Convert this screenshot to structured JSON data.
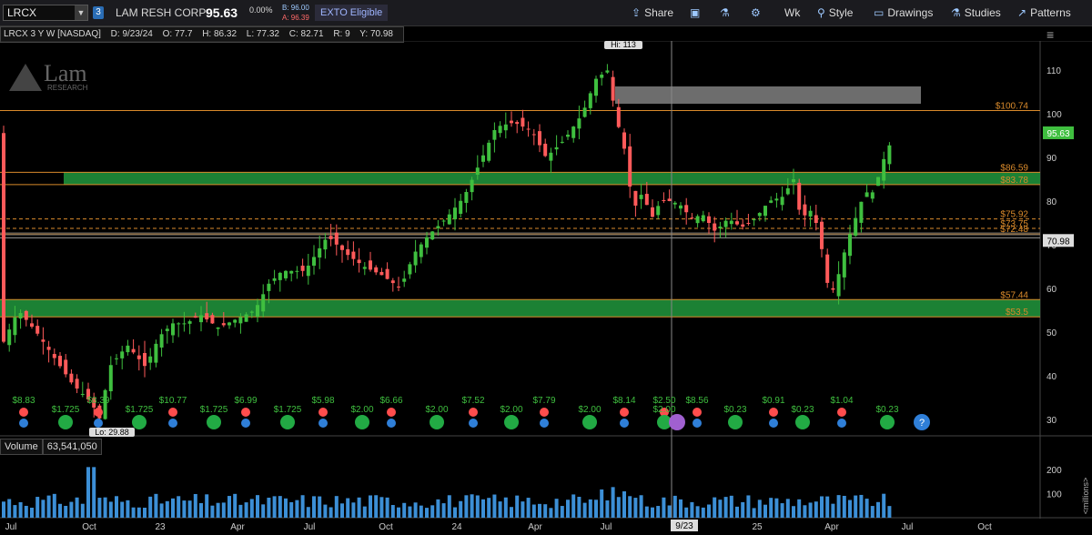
{
  "toolbar": {
    "symbol": "LRCX",
    "link_badge": "3",
    "company": "LAM RESH CORP",
    "last_price": "95.63",
    "change_pct": "0.00%",
    "bid": "B: 96.00",
    "ask": "A: 96.39",
    "exto": "EXTO Eligible",
    "share": "Share",
    "period": "Wk",
    "style": "Style",
    "drawings": "Drawings",
    "studies": "Studies",
    "patterns": "Patterns"
  },
  "info": {
    "title": "LRCX 3 Y W [NASDAQ]",
    "date": "D: 9/23/24",
    "open": "O: 77.7",
    "high": "H: 86.32",
    "low": "L: 77.32",
    "close": "C: 82.71",
    "range": "R: 9",
    "y": "Y: 70.98"
  },
  "logo": {
    "text": "Lam",
    "sub": "RESEARCH"
  },
  "hi_label": "Hi: 113",
  "low_label": "Lo: 29.88",
  "price_labels": {
    "last": "95.63",
    "cursor": "70.98"
  },
  "levels": [
    {
      "label": "$100.74",
      "value": 100.74
    },
    {
      "label": "$86.59",
      "value": 86.59
    },
    {
      "label": "$83.78",
      "value": 83.78
    },
    {
      "label": "$75.92",
      "value": 75.92
    },
    {
      "label": "$73.75",
      "value": 73.75
    },
    {
      "label": "$72.48",
      "value": 72.48
    },
    {
      "label": "$57.44",
      "value": 57.44
    },
    {
      "label": "$53.5",
      "value": 53.5
    }
  ],
  "y_ticks": [
    "110",
    "100",
    "90",
    "80",
    "70",
    "60",
    "50",
    "40",
    "30"
  ],
  "x_ticks": [
    "Jul",
    "Oct",
    "23",
    "Apr",
    "Jul",
    "Oct",
    "24",
    "Apr",
    "Jul",
    "9/23",
    "25",
    "Apr",
    "Jul",
    "Oct"
  ],
  "events": {
    "dividends": [
      "$1.725",
      "$1.725",
      "$1.725",
      "$1.725",
      "$2.00",
      "$2.00",
      "$2.00",
      "$2.00",
      "$2.00",
      "$0.23",
      "$0.23",
      "$0.23",
      "$0.23"
    ],
    "earnings": [
      "$8.83",
      "$8.39",
      "$10.77",
      "$6.99",
      "$5.98",
      "$6.66",
      "$7.52",
      "$7.79",
      "$8.14",
      "$2.50",
      "$8.56",
      "$0.91",
      "$1.04"
    ]
  },
  "volume": {
    "label": "Volume",
    "value": "63,541,050",
    "ticks": [
      "200",
      "100"
    ],
    "unit": "<millions>"
  },
  "colors": {
    "up": "#3fbf3f",
    "down": "#ff5a5a",
    "zone": "#1f8f3a",
    "level": "#d98a2b",
    "volume": "#3c8fd6"
  }
}
